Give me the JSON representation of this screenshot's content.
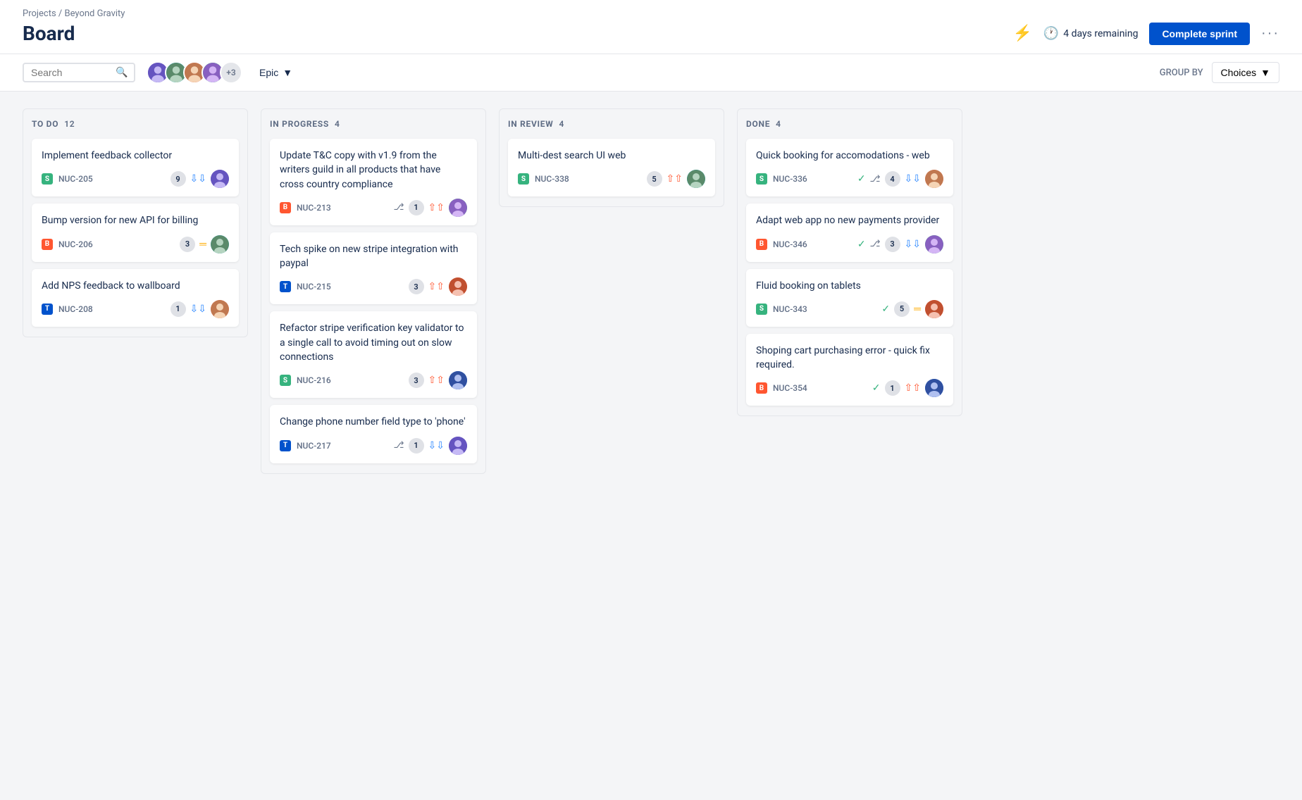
{
  "breadcrumb": "Projects / Beyond Gravity",
  "title": "Board",
  "header": {
    "time_remaining": "4 days remaining",
    "complete_sprint_label": "Complete sprint",
    "more_label": "···"
  },
  "toolbar": {
    "search_placeholder": "Search",
    "avatar_extra": "+3",
    "epic_label": "Epic",
    "group_by_label": "GROUP BY",
    "choices_label": "Choices"
  },
  "columns": [
    {
      "id": "todo",
      "label": "TO DO",
      "count": 12,
      "cards": [
        {
          "title": "Implement feedback collector",
          "issue_type": "story",
          "issue_id": "NUC-205",
          "count": 9,
          "priority": "low",
          "avatar": "av1"
        },
        {
          "title": "Bump version for new API for billing",
          "issue_type": "bug",
          "issue_id": "NUC-206",
          "count": 3,
          "priority": "medium",
          "avatar": "av2"
        },
        {
          "title": "Add NPS feedback to wallboard",
          "issue_type": "task",
          "issue_id": "NUC-208",
          "count": 1,
          "priority": "lowest",
          "avatar": "av3"
        }
      ]
    },
    {
      "id": "inprogress",
      "label": "IN PROGRESS",
      "count": 4,
      "cards": [
        {
          "title": "Update T&C copy with v1.9 from the writers guild in all products that have cross country compliance",
          "issue_type": "bug",
          "issue_id": "NUC-213",
          "count": 1,
          "priority": "high",
          "avatar": "av4",
          "has_branch": true
        },
        {
          "title": "Tech spike on new stripe integration with paypal",
          "issue_type": "task",
          "issue_id": "NUC-215",
          "count": 3,
          "priority": "high",
          "avatar": "av5"
        },
        {
          "title": "Refactor stripe verification key validator to a single call to avoid timing out on slow connections",
          "issue_type": "story",
          "issue_id": "NUC-216",
          "count": 3,
          "priority": "high",
          "avatar": "av6"
        },
        {
          "title": "Change phone number field type to 'phone'",
          "issue_type": "task",
          "issue_id": "NUC-217",
          "count": 1,
          "priority": "lowest",
          "avatar": "av1",
          "has_branch": true
        }
      ]
    },
    {
      "id": "inreview",
      "label": "IN REVIEW",
      "count": 4,
      "cards": [
        {
          "title": "Multi-dest search UI web",
          "issue_type": "story",
          "issue_id": "NUC-338",
          "count": 5,
          "priority": "high",
          "avatar": "av2"
        }
      ]
    },
    {
      "id": "done",
      "label": "DONE",
      "count": 4,
      "cards": [
        {
          "title": "Quick booking for accomodations - web",
          "issue_type": "story",
          "issue_id": "NUC-336",
          "count": 4,
          "priority": "lowest",
          "avatar": "av3",
          "has_check": true,
          "has_branch": true
        },
        {
          "title": "Adapt web app no new payments provider",
          "issue_type": "bug",
          "issue_id": "NUC-346",
          "count": 3,
          "priority": "low",
          "avatar": "av4",
          "has_check": true,
          "has_branch": true
        },
        {
          "title": "Fluid booking on tablets",
          "issue_type": "story",
          "issue_id": "NUC-343",
          "count": 5,
          "priority": "medium",
          "avatar": "av5",
          "has_check": true
        },
        {
          "title": "Shoping cart purchasing error - quick fix required.",
          "issue_type": "bug",
          "issue_id": "NUC-354",
          "count": 1,
          "priority": "highest",
          "avatar": "av6",
          "has_check": true
        }
      ]
    }
  ]
}
